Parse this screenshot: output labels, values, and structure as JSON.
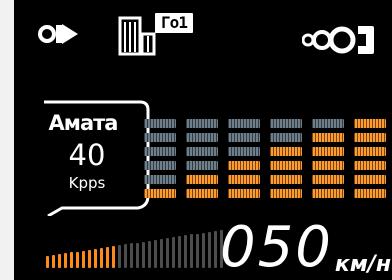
{
  "header": {
    "icons": [
      "camera-icon",
      "city-mode-icon",
      "connection-icon"
    ],
    "mode_badge": "Го1"
  },
  "detector": {
    "signal_name": "Амата",
    "value": "40",
    "unit": "Kpps"
  },
  "signal_meter": {
    "levels": [
      1,
      2,
      3,
      4,
      5,
      6
    ],
    "max_level": 6,
    "active_color": "#ff9a2e",
    "inactive_color": "#6e7f8c"
  },
  "speed": {
    "value": "050",
    "unit": "км/н",
    "gauge_fill": 0.4
  }
}
